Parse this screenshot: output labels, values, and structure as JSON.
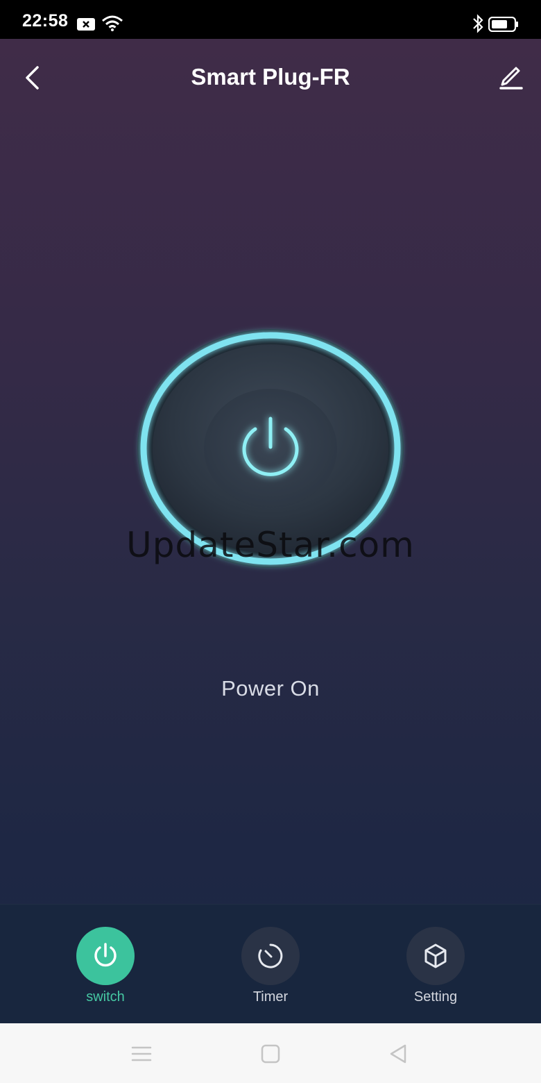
{
  "status_bar": {
    "time": "22:58"
  },
  "header": {
    "title": "Smart Plug-FR"
  },
  "device": {
    "status_text": "Power On",
    "accent_color": "#7fe3f0"
  },
  "watermark": "UpdateStar.com",
  "tabs": [
    {
      "label": "switch",
      "icon": "power-icon",
      "active": true
    },
    {
      "label": "Timer",
      "icon": "timer-icon",
      "active": false
    },
    {
      "label": "Setting",
      "icon": "cube-icon",
      "active": false
    }
  ],
  "colors": {
    "active_tab": "#3cc39d",
    "background_top": "#402c48",
    "background_bottom": "#1b2843"
  }
}
